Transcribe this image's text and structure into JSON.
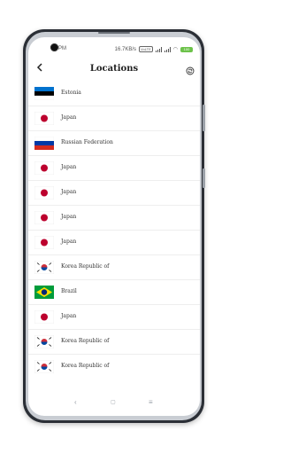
{
  "status_bar": {
    "time": "PM",
    "speed": "16.7KB/s",
    "network_badge": "VoLTE",
    "battery": "100"
  },
  "header": {
    "title": "Locations",
    "back_icon": "back-arrow-icon",
    "action_icon": "refresh-icon"
  },
  "locations": [
    {
      "country": "Estonia",
      "flag": "estonia"
    },
    {
      "country": "Japan",
      "flag": "japan"
    },
    {
      "country": "Russian Federation",
      "flag": "russia"
    },
    {
      "country": "Japan",
      "flag": "japan"
    },
    {
      "country": "Japan",
      "flag": "japan"
    },
    {
      "country": "Japan",
      "flag": "japan"
    },
    {
      "country": "Japan",
      "flag": "japan"
    },
    {
      "country": "Korea Republic of",
      "flag": "korea"
    },
    {
      "country": "Brazil",
      "flag": "brazil"
    },
    {
      "country": "Japan",
      "flag": "japan"
    },
    {
      "country": "Korea Republic of",
      "flag": "korea"
    },
    {
      "country": "Korea Republic of",
      "flag": "korea"
    }
  ],
  "nav": {
    "back": "‹",
    "home": "▢",
    "menu": "≡"
  },
  "colors": {
    "japan_red": "#bc002d",
    "estonia_blue": "#0072ce",
    "russia_blue": "#0039a6",
    "russia_red": "#d52b1e",
    "brazil_green": "#009c3b",
    "brazil_yellow": "#ffdf00",
    "brazil_blue": "#002776",
    "korea_red": "#cd2e3a",
    "korea_blue": "#0047a0"
  }
}
